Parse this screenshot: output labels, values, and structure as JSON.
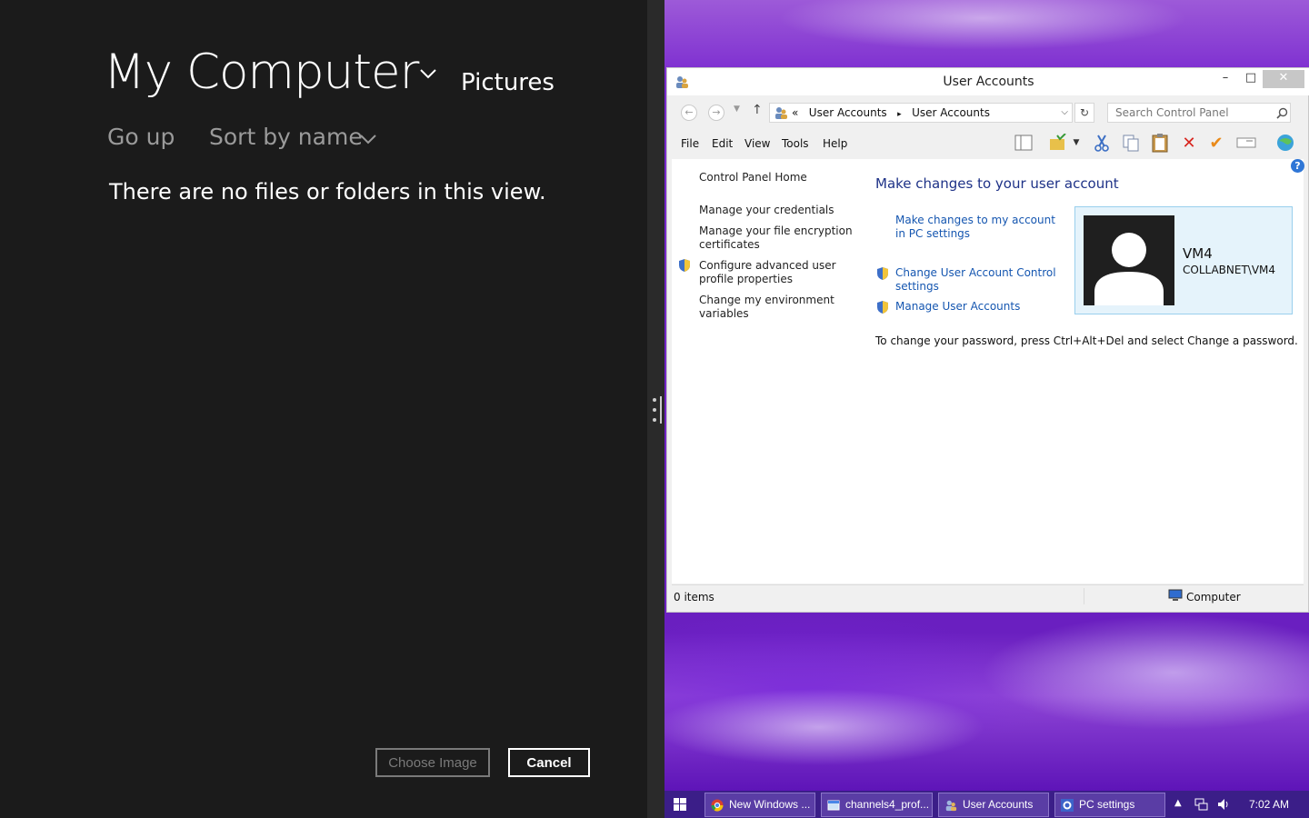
{
  "picker": {
    "title": "My Computer",
    "location": "Pictures",
    "go_up": "Go up",
    "sort": "Sort by name",
    "empty_message": "There are no files or folders in this view.",
    "choose_button": "Choose Image",
    "cancel_button": "Cancel"
  },
  "window": {
    "title": "User Accounts",
    "controls": {
      "minimize": "–",
      "maximize": "□",
      "close": "✕"
    },
    "address": {
      "chevrons": "«",
      "crumbs": [
        "User Accounts",
        "User Accounts"
      ],
      "separator": "▸"
    },
    "search_placeholder": "Search Control Panel",
    "menu": [
      "File",
      "Edit",
      "View",
      "Tools",
      "Help"
    ],
    "sidebar": {
      "home": "Control Panel Home",
      "links": [
        "Manage your credentials",
        "Manage your file encryption certificates",
        "Configure advanced user profile properties",
        "Change my environment variables"
      ]
    },
    "main": {
      "heading": "Make changes to your user account",
      "links": [
        "Make changes to my account in PC settings",
        "Change User Account Control settings",
        "Manage User Accounts"
      ],
      "account": {
        "name": "VM4",
        "domain": "COLLABNET\\VM4"
      },
      "password_note": "To change your password, press Ctrl+Alt+Del and select Change a password."
    },
    "status": {
      "items": "0 items",
      "location": "Computer"
    }
  },
  "taskbar": {
    "buttons": [
      "New Windows ...",
      "channels4_prof...",
      "User Accounts",
      "PC settings"
    ],
    "clock": "7:02 AM"
  },
  "colors": {
    "accent": "#1e3287",
    "link": "#1556b0",
    "taskbar": "#3b1e88"
  }
}
